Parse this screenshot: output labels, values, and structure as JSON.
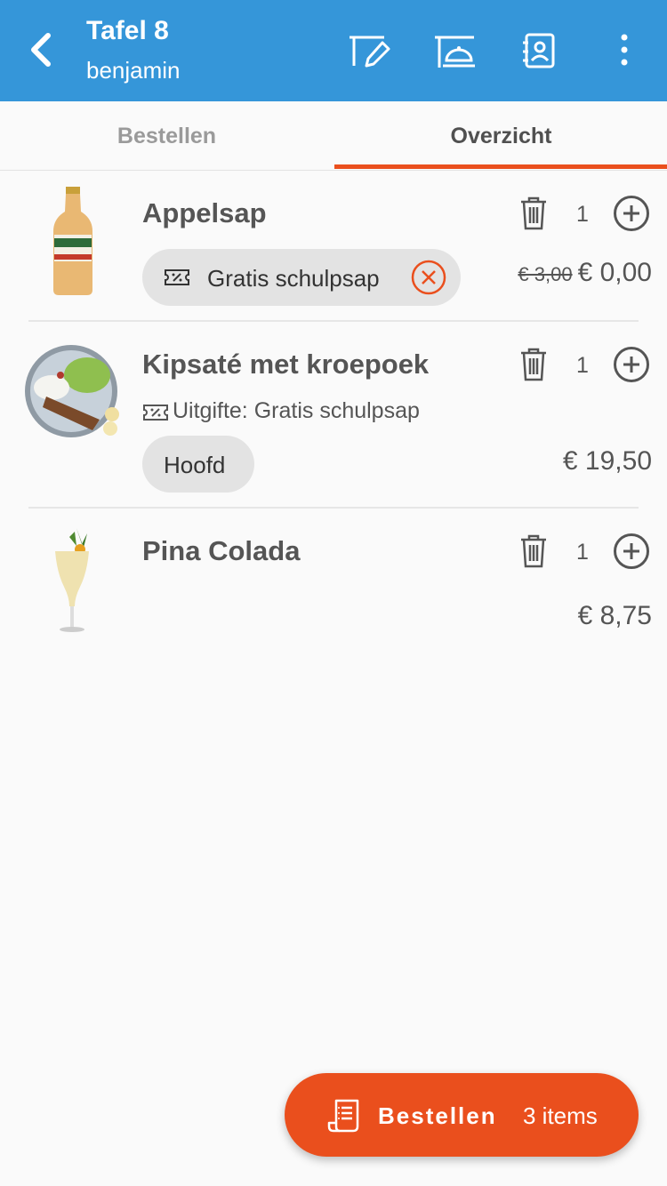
{
  "header": {
    "title": "Tafel 8",
    "subtitle": "benjamin",
    "icons": [
      "back-icon",
      "edit-table-icon",
      "table-service-icon",
      "contact-book-icon",
      "more-vert-icon"
    ],
    "color": "#3596d9"
  },
  "tabs": [
    {
      "label": "Bestellen",
      "active": false
    },
    {
      "label": "Overzicht",
      "active": true
    }
  ],
  "accent": "#ea4f1d",
  "items": [
    {
      "name": "Appelsap",
      "quantity": "1",
      "old_price": "€ 3,00",
      "price": "€ 0,00",
      "chip": "Gratis schulpsap"
    },
    {
      "name": "Kipsaté met kroepoek",
      "quantity": "1",
      "info": "Uitgifte: Gratis schulpsap",
      "chip": "Hoofd",
      "price": "€ 19,50"
    },
    {
      "name": "Pina Colada",
      "quantity": "1",
      "price": "€ 8,75"
    }
  ],
  "fab": {
    "label": "Bestellen",
    "count": "3 items"
  }
}
